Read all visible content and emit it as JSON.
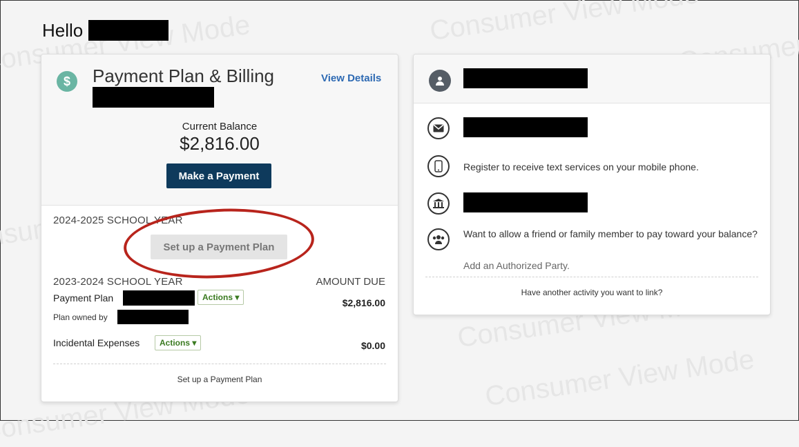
{
  "watermark": {
    "text": "Consumer View Mode"
  },
  "greeting": {
    "text": "Hello"
  },
  "plan_card": {
    "title": "Payment Plan & Billing",
    "view_details": "View Details",
    "balance_label": "Current Balance",
    "balance_amount": "$2,816.00",
    "make_payment": "Make a Payment",
    "year_2025": "2024-2025 SCHOOL YEAR",
    "setup_plan_button": "Set up a Payment Plan",
    "year_2024": "2023-2024 SCHOOL YEAR",
    "amount_due_header": "AMOUNT DUE",
    "rows": [
      {
        "label": "Payment Plan",
        "actions": "Actions",
        "amount": "$2,816.00"
      },
      {
        "label": "Incidental Expenses",
        "actions": "Actions",
        "amount": "$0.00"
      }
    ],
    "owned_by": "Plan owned by",
    "footer_link": "Set up a Payment Plan"
  },
  "contact_card": {
    "text_services": "Register to receive text services on your mobile phone.",
    "authorized_prompt": "Want to allow a friend or family member to pay toward your balance?",
    "authorized_link": "Add an Authorized Party.",
    "footer_link": "Have another activity you want to link?"
  },
  "colors": {
    "accent": "#0e3a5c",
    "link": "#2e6ab3",
    "annotation": "#b8241c",
    "badge": "#6ab5a3"
  }
}
